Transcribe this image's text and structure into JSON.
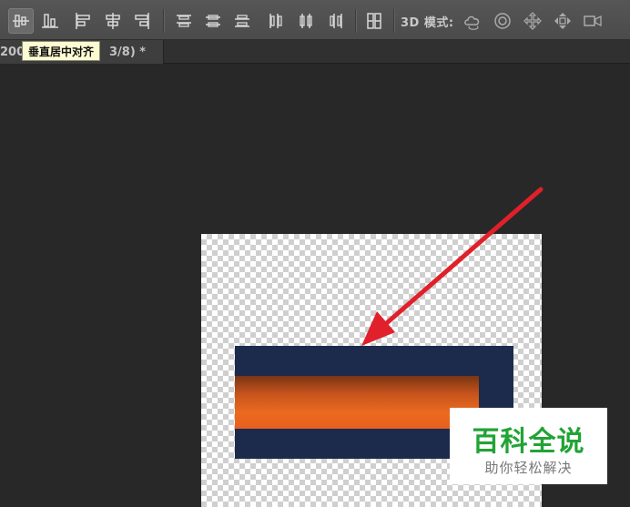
{
  "tooltip": {
    "text": "垂直居中对齐"
  },
  "document_tab": {
    "title_prefix": "200",
    "title_suffix": "3/8) *"
  },
  "options_bar": {
    "mode_label": "3D 模式:",
    "tools": [
      {
        "name": "align-vertical-centers",
        "active": true
      },
      {
        "name": "align-bottom-edges"
      },
      {
        "name": "align-left-edges"
      },
      {
        "name": "align-horizontal-centers"
      },
      {
        "name": "align-right-edges"
      },
      {
        "name": "distribute-top-edges"
      },
      {
        "name": "distribute-vertical-centers"
      },
      {
        "name": "distribute-bottom-edges"
      },
      {
        "name": "distribute-left-edges"
      },
      {
        "name": "distribute-horizontal-centers"
      },
      {
        "name": "distribute-right-edges"
      },
      {
        "name": "auto-align-layers"
      }
    ],
    "mode_tools": [
      "rotate-3d-icon",
      "roll-3d-icon",
      "drag-3d-icon",
      "slide-3d-icon",
      "scale-3d-icon"
    ]
  },
  "watermark": {
    "title": "百科全说",
    "subtitle": "助你轻松解决"
  },
  "colors": {
    "annotation_arrow": "#e0202a",
    "navy_layer": "#1c2a4c",
    "orange_layer": "#ec6a21",
    "watermark_green": "#22a336"
  }
}
